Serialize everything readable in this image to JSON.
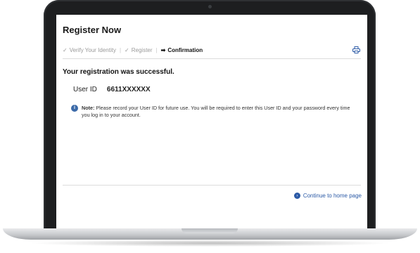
{
  "page": {
    "title": "Register Now"
  },
  "steps": [
    {
      "label": "Verify Your Identity",
      "state": "done"
    },
    {
      "label": "Register",
      "state": "done"
    },
    {
      "label": "Confirmation",
      "state": "current"
    }
  ],
  "message": {
    "success": "Your registration was successful."
  },
  "user": {
    "id_label": "User ID",
    "id_value": "6611XXXXXX"
  },
  "note": {
    "label": "Note:",
    "text": "Please record your User ID for future use. You will be required to enter this User ID and your password every time you log in to your account."
  },
  "actions": {
    "continue_label": "Continue to home page"
  },
  "icons": {
    "print": "print-icon",
    "info": "info-icon",
    "check": "check-icon",
    "arrow": "arrow-right-icon",
    "continue": "circle-arrow-icon"
  },
  "colors": {
    "link": "#2b5aa6",
    "info": "#3b6aa8"
  }
}
